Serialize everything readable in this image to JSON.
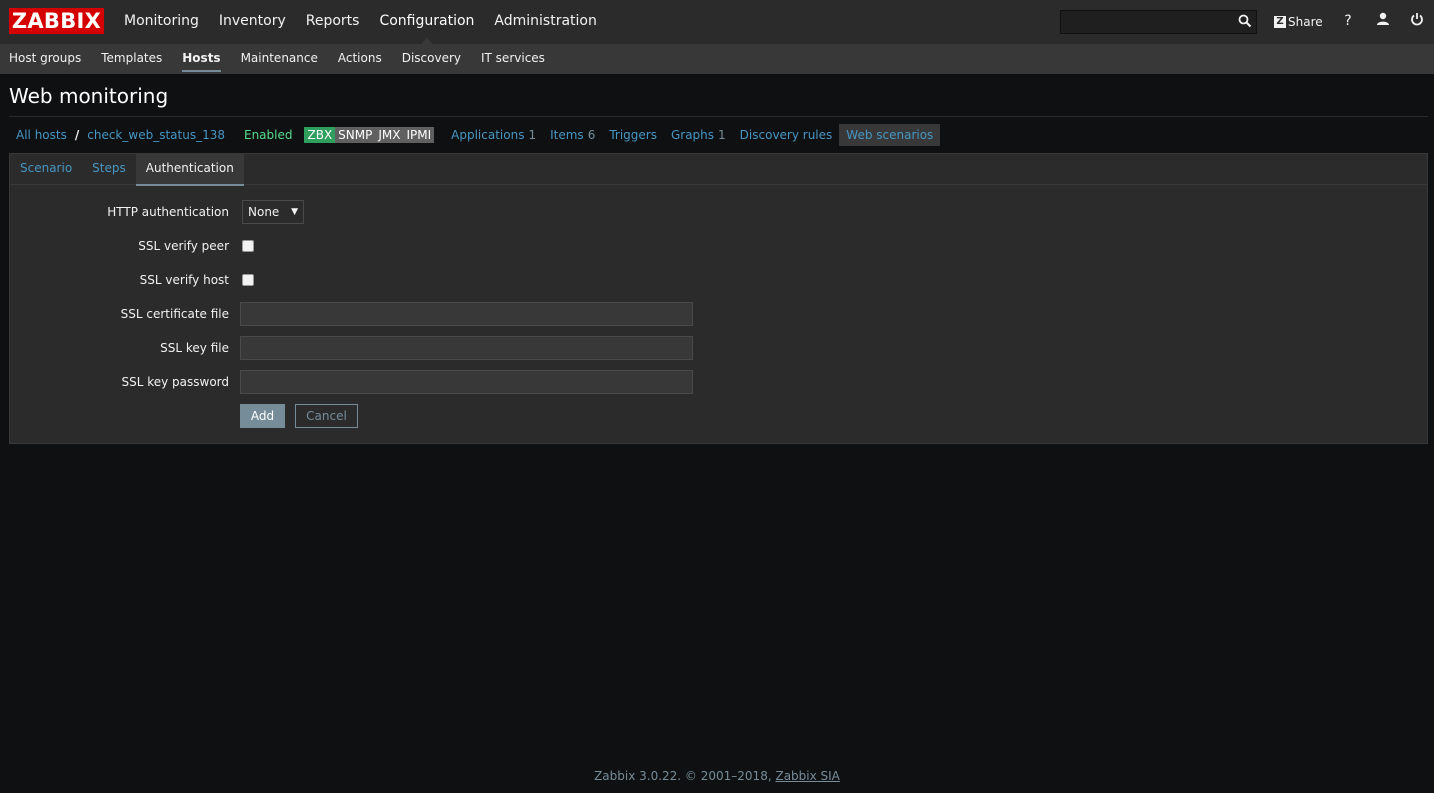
{
  "header": {
    "logo": "ZABBIX",
    "menu": [
      {
        "label": "Monitoring",
        "selected": false
      },
      {
        "label": "Inventory",
        "selected": false
      },
      {
        "label": "Reports",
        "selected": false
      },
      {
        "label": "Configuration",
        "selected": true
      },
      {
        "label": "Administration",
        "selected": false
      }
    ],
    "search_value": "",
    "share_label": "Share",
    "share_badge": "Z",
    "help_glyph": "?",
    "icons": [
      "search-icon",
      "user-icon",
      "power-icon"
    ]
  },
  "submenu": [
    {
      "label": "Host groups",
      "selected": false
    },
    {
      "label": "Templates",
      "selected": false
    },
    {
      "label": "Hosts",
      "selected": true
    },
    {
      "label": "Maintenance",
      "selected": false
    },
    {
      "label": "Actions",
      "selected": false
    },
    {
      "label": "Discovery",
      "selected": false
    },
    {
      "label": "IT services",
      "selected": false
    }
  ],
  "page_title": "Web monitoring",
  "host_nav": {
    "all_hosts": "All hosts",
    "separator": "/",
    "host_name": "check_web_status_138",
    "status": "Enabled",
    "availability": [
      "ZBX",
      "SNMP",
      "JMX",
      "IPMI"
    ],
    "links": [
      {
        "label": "Applications",
        "count": "1"
      },
      {
        "label": "Items",
        "count": "6"
      },
      {
        "label": "Triggers",
        "count": ""
      },
      {
        "label": "Graphs",
        "count": "1"
      },
      {
        "label": "Discovery rules",
        "count": ""
      },
      {
        "label": "Web scenarios",
        "count": ""
      }
    ]
  },
  "tabs": [
    {
      "label": "Scenario",
      "active": false
    },
    {
      "label": "Steps",
      "active": false
    },
    {
      "label": "Authentication",
      "active": true
    }
  ],
  "form": {
    "http_auth_label": "HTTP authentication",
    "http_auth_value": "None",
    "ssl_verify_peer_label": "SSL verify peer",
    "ssl_verify_peer_checked": false,
    "ssl_verify_host_label": "SSL verify host",
    "ssl_verify_host_checked": false,
    "ssl_cert_label": "SSL certificate file",
    "ssl_cert_value": "",
    "ssl_key_label": "SSL key file",
    "ssl_key_value": "",
    "ssl_key_password_label": "SSL key password",
    "ssl_key_password_value": "",
    "add_label": "Add",
    "cancel_label": "Cancel"
  },
  "footer": {
    "text": "Zabbix 3.0.22. © 2001–2018, ",
    "link": "Zabbix SIA"
  },
  "colors": {
    "accent": "#d40000",
    "link": "#4796c4",
    "enabled": "#59db8f",
    "zbx_available": "#2f9f5e"
  }
}
